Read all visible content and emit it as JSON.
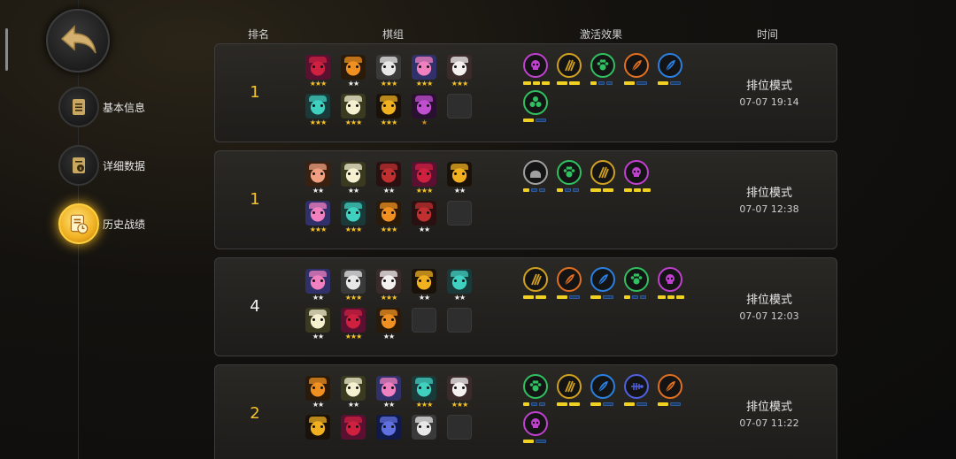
{
  "sidebar": {
    "items": [
      {
        "label": "基本信息",
        "icon": "clipboard-icon",
        "active": false
      },
      {
        "label": "详细数据",
        "icon": "info-document-icon",
        "active": false
      },
      {
        "label": "历史战绩",
        "icon": "history-clock-icon",
        "active": true
      }
    ]
  },
  "headers": {
    "rank": "排名",
    "units": "棋组",
    "traits": "激活效果",
    "time": "时间"
  },
  "colors": {
    "accent_gold": "#f2c230",
    "trait_purple": "#c040d0",
    "trait_green": "#30c060",
    "trait_gold": "#d0a020",
    "trait_orange": "#e07020",
    "trait_blue": "#2a80e0",
    "trait_grey": "#a0a0a0"
  },
  "matches": [
    {
      "rank": "1",
      "rank_color": "gold",
      "mode": "排位模式",
      "time": "07-07 19:14",
      "units": [
        [
          {
            "stars": "★★★",
            "tier": 3,
            "hero": "red-horned-demon"
          },
          {
            "stars": "★★",
            "tier": 2,
            "hero": "orange-beast"
          },
          {
            "stars": "★★★",
            "tier": 3,
            "hero": "white-knight"
          },
          {
            "stars": "★★★",
            "tier": 3,
            "hero": "pink-hat-goggles"
          },
          {
            "stars": "★★★",
            "tier": 3,
            "hero": "red-hat-sheep"
          }
        ],
        [
          {
            "stars": "★★★",
            "tier": 3,
            "hero": "teal-chest"
          },
          {
            "stars": "★★★",
            "tier": 3,
            "hero": "white-cowboy"
          },
          {
            "stars": "★★★",
            "tier": 3,
            "hero": "gold-hood-ninja"
          },
          {
            "stars": "★",
            "tier": 1,
            "hero": "purple-mask"
          },
          null
        ]
      ],
      "traits": [
        {
          "icon": "demon-skull-icon",
          "color": "#c040d0",
          "on": 3,
          "total": 3
        },
        {
          "icon": "claw-slash-icon",
          "color": "#d0a020",
          "on": 2,
          "total": 2
        },
        {
          "icon": "paw-print-icon",
          "color": "#30c060",
          "on": 1,
          "total": 3
        },
        {
          "icon": "feather-icon",
          "color": "#e07020",
          "on": 1,
          "total": 2
        },
        {
          "icon": "feather-icon",
          "color": "#2a80e0",
          "on": 1,
          "total": 2
        },
        {
          "icon": "triple-orb-icon",
          "color": "#30c060",
          "on": 1,
          "total": 2
        }
      ]
    },
    {
      "rank": "1",
      "rank_color": "gold",
      "mode": "排位模式",
      "time": "07-07 12:38",
      "units": [
        [
          {
            "stars": "★★",
            "tier": 2,
            "hero": "goggle-brawler"
          },
          {
            "stars": "★★",
            "tier": 2,
            "hero": "white-cowboy"
          },
          {
            "stars": "★★",
            "tier": 2,
            "hero": "red-hat-pirate"
          },
          {
            "stars": "★★★",
            "tier": 3,
            "hero": "red-horned-demon"
          },
          {
            "stars": "★★",
            "tier": 2,
            "hero": "gold-hood-ninja"
          }
        ],
        [
          {
            "stars": "★★★",
            "tier": 3,
            "hero": "pink-hat-goggles"
          },
          {
            "stars": "★★★",
            "tier": 3,
            "hero": "teal-chest"
          },
          {
            "stars": "★★★",
            "tier": 3,
            "hero": "orange-beast"
          },
          {
            "stars": "★★",
            "tier": 2,
            "hero": "red-hat-pirate"
          },
          null
        ]
      ],
      "traits": [
        {
          "icon": "helmet-icon",
          "color": "#a0a0a0",
          "on": 1,
          "total": 3
        },
        {
          "icon": "paw-print-icon",
          "color": "#30c060",
          "on": 1,
          "total": 3
        },
        {
          "icon": "claw-slash-icon",
          "color": "#d0a020",
          "on": 2,
          "total": 2
        },
        {
          "icon": "demon-skull-icon",
          "color": "#c040d0",
          "on": 3,
          "total": 3
        }
      ]
    },
    {
      "rank": "4",
      "rank_color": "white",
      "mode": "排位模式",
      "time": "07-07 12:03",
      "units": [
        [
          {
            "stars": "★★",
            "tier": 2,
            "hero": "pink-hat-goggles"
          },
          {
            "stars": "★★★",
            "tier": 3,
            "hero": "white-knight"
          },
          {
            "stars": "★★★",
            "tier": 3,
            "hero": "red-hat-sheep"
          },
          {
            "stars": "★★",
            "tier": 2,
            "hero": "gold-hood-ninja"
          },
          {
            "stars": "★★",
            "tier": 2,
            "hero": "teal-chest"
          }
        ],
        [
          {
            "stars": "★★",
            "tier": 2,
            "hero": "white-cowboy"
          },
          {
            "stars": "★★★",
            "tier": 3,
            "hero": "red-horned-demon"
          },
          {
            "stars": "★★",
            "tier": 2,
            "hero": "orange-beast"
          },
          null,
          null
        ]
      ],
      "traits": [
        {
          "icon": "claw-slash-icon",
          "color": "#d0a020",
          "on": 2,
          "total": 2
        },
        {
          "icon": "feather-icon",
          "color": "#e07020",
          "on": 1,
          "total": 2
        },
        {
          "icon": "feather-icon",
          "color": "#2a80e0",
          "on": 1,
          "total": 2
        },
        {
          "icon": "paw-print-icon",
          "color": "#30c060",
          "on": 1,
          "total": 3
        },
        {
          "icon": "demon-skull-icon",
          "color": "#c040d0",
          "on": 3,
          "total": 3
        }
      ]
    },
    {
      "rank": "2",
      "rank_color": "gold",
      "mode": "排位模式",
      "time": "07-07 11:22",
      "units": [
        [
          {
            "stars": "★★",
            "tier": 2,
            "hero": "orange-beast"
          },
          {
            "stars": "★★",
            "tier": 2,
            "hero": "white-cowboy"
          },
          {
            "stars": "★★",
            "tier": 2,
            "hero": "pink-hat-goggles"
          },
          {
            "stars": "★★★",
            "tier": 3,
            "hero": "teal-chest"
          },
          {
            "stars": "★★★",
            "tier": 3,
            "hero": "red-hat-sheep"
          }
        ],
        [
          {
            "stars": "",
            "tier": 0,
            "hero": "gold-hood-ninja"
          },
          {
            "stars": "",
            "tier": 0,
            "hero": "red-horned-demon"
          },
          {
            "stars": "",
            "tier": 0,
            "hero": "blue-hood-mage"
          },
          {
            "stars": "",
            "tier": 0,
            "hero": "white-knight"
          },
          null
        ]
      ],
      "traits": [
        {
          "icon": "paw-print-icon",
          "color": "#30c060",
          "on": 1,
          "total": 3
        },
        {
          "icon": "claw-slash-icon",
          "color": "#d0a020",
          "on": 2,
          "total": 2
        },
        {
          "icon": "feather-icon",
          "color": "#2a80e0",
          "on": 1,
          "total": 2
        },
        {
          "icon": "fish-bone-icon",
          "color": "#5060e0",
          "on": 1,
          "total": 2
        },
        {
          "icon": "feather-icon",
          "color": "#e07020",
          "on": 1,
          "total": 2
        },
        {
          "icon": "demon-skull-icon",
          "color": "#c040d0",
          "on": 1,
          "total": 2
        }
      ]
    }
  ]
}
